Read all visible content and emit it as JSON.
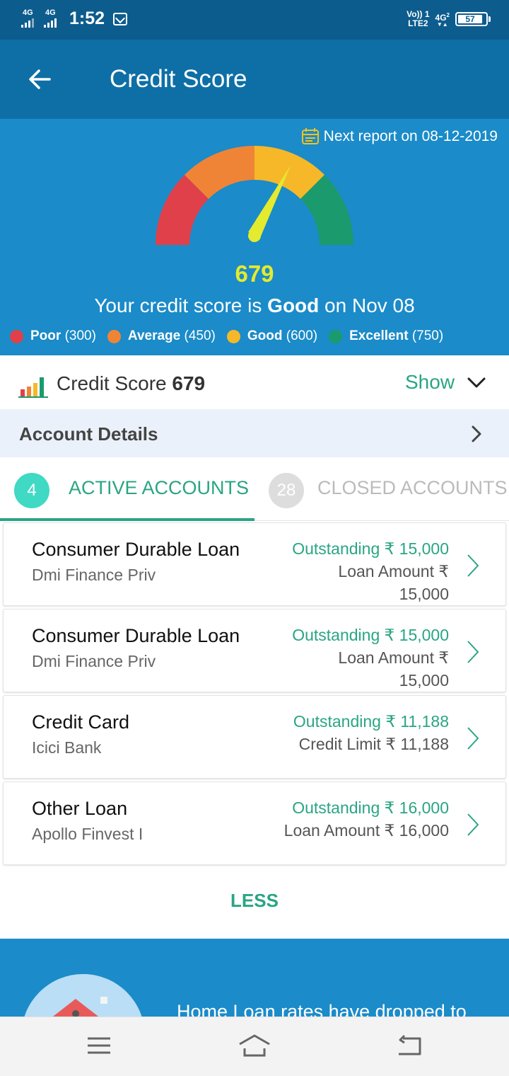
{
  "status_bar": {
    "network_left_1": "4G",
    "network_left_2": "4G",
    "time": "1:52",
    "volte_line1": "Vo)) 1",
    "volte_line2": "LTE2",
    "network_right": "4G",
    "network_right_sub": "2",
    "battery": "57"
  },
  "app_bar": {
    "title": "Credit Score"
  },
  "hero": {
    "next_report": "Next report on 08-12-2019",
    "score": "679",
    "score_line_prefix": "Your credit score is ",
    "score_line_rating": "Good",
    "score_line_suffix": " on Nov 08",
    "gauge_fraction": 0.63,
    "legend": [
      {
        "label": "Poor",
        "value": "(300)",
        "color": "#e0404a"
      },
      {
        "label": "Average",
        "value": "(450)",
        "color": "#f08436"
      },
      {
        "label": "Good",
        "value": "(600)",
        "color": "#f6b829"
      },
      {
        "label": "Excellent",
        "value": "(750)",
        "color": "#1b9a6e"
      }
    ]
  },
  "credit_score_row": {
    "label": "Credit Score",
    "value": "679",
    "action": "Show"
  },
  "account_details": {
    "label": "Account Details"
  },
  "tabs": {
    "active": {
      "count": "4",
      "label": "ACTIVE ACCOUNTS"
    },
    "closed": {
      "count": "28",
      "label": "CLOSED ACCOUNTS"
    }
  },
  "accounts": [
    {
      "name": "Consumer Durable Loan",
      "lender": "Dmi Finance Priv",
      "outstanding": "Outstanding ₹ 15,000",
      "amount_line1": "Loan Amount ₹",
      "amount_line2": "15,000"
    },
    {
      "name": "Consumer Durable Loan",
      "lender": "Dmi Finance Priv",
      "outstanding": "Outstanding ₹ 15,000",
      "amount_line1": "Loan Amount ₹",
      "amount_line2": "15,000"
    },
    {
      "name": "Credit Card",
      "lender": "Icici Bank",
      "outstanding": "Outstanding ₹ 11,188",
      "amount_line1": "Credit Limit ₹ 11,188",
      "amount_line2": ""
    },
    {
      "name": "Other Loan",
      "lender": "Apollo Finvest I",
      "outstanding": "Outstanding ₹ 16,000",
      "amount_line1": "Loan Amount ₹ 16,000",
      "amount_line2": ""
    }
  ],
  "less_button": "LESS",
  "promo": {
    "text": "Home Loan rates have dropped to"
  },
  "colors": {
    "accent": "#2aa584",
    "header": "#0e6fa6",
    "hero": "#1b8bc9",
    "score": "#e4ea2e"
  },
  "icons": {
    "back": "arrow-left-icon",
    "calendar": "calendar-icon",
    "chart": "bar-chart-icon",
    "chevron_down": "chevron-down-icon",
    "chevron_right": "chevron-right-icon",
    "menu": "menu-icon",
    "home": "home-icon",
    "back_nav": "return-icon"
  }
}
